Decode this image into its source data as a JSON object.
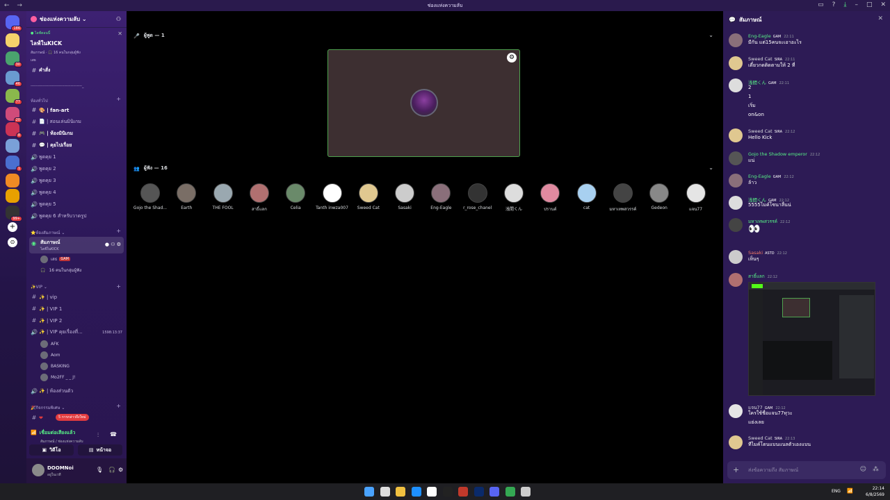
{
  "window": {
    "title": "ช่องแห่งความลับ",
    "nav": "← →"
  },
  "servers": [
    {
      "color": "#5865f2",
      "badge": "186"
    },
    {
      "color": "#f5d36b",
      "badge": ""
    },
    {
      "color": "#4aa36e",
      "badge": "30"
    },
    {
      "color": "#6a9ad0",
      "badge": "46"
    },
    {
      "color": "#8ab84c",
      "badge": "77"
    },
    {
      "color": "#d04b7a",
      "badge": "20"
    },
    {
      "color": "#cc3355",
      "badge": "8"
    },
    {
      "color": "#7aa0d8",
      "badge": ""
    },
    {
      "color": "#4a6fd0",
      "badge": "1"
    },
    {
      "color": "#f08a24",
      "badge": ""
    },
    {
      "color": "#e8a000",
      "badge": ""
    },
    {
      "color": "#333",
      "badge": "99+"
    }
  ],
  "server_header": {
    "name": "ช่องแห่งความลับ ⌄"
  },
  "event": {
    "label": "● ไลฟ์ตอนนี้",
    "title": "ไลฟ์ในKICK",
    "sub": "สัมภาษณ์ · 🎧 16 คนในกลุ่มผู้ฟัง",
    "sub2": "เสธ"
  },
  "channels": {
    "commands": "คำสั่ง",
    "divider": "-----------------------------------------_",
    "cat_general": "ห้องทั่วไป",
    "items": [
      "🎨 | fan-art",
      "📄 | สอนเล่นมินิเกม",
      "🎮 | ห้องมินิเกม",
      "💬 | คุยไปเรื่อย"
    ],
    "talk": [
      "พูดคุย 1",
      "พูดคุย 2",
      "พูดคุย 3",
      "พูดคุย 4",
      "พูดคุย 5",
      "พูดคุย 6 สำหรับวาดรูป"
    ],
    "cat_interview": "⭐ห้องสัมภาษณ์ ⌄",
    "active_stage": "สัมภาษณ์",
    "active_sub": "ไลฟ์ในKICK",
    "stage_user": "เสธ",
    "stage_tag": "GAM",
    "stage_listeners": "16 คนในกลุ่มผู้ฟัง",
    "cat_vip": "✨VIP ⌄",
    "vip": [
      "✨ | vip",
      "✨ | VIP 1",
      "✨ | VIP 2"
    ],
    "vip_voice": "✨ | VIP คุยเรื่องที่...",
    "vip_timer": "1598:13:37",
    "vip_users": [
      "AFK",
      "Aom",
      "BASKING",
      "Mo2FF _ _ J!"
    ],
    "private": "✨ | ห้องส่วนตัว",
    "cat_events": "🎉กิจกรรมพิเศษ ⌄",
    "new_msg": "5 การกล่าวถึงใหม่"
  },
  "voice": {
    "status": "เชื่อมต่อเสียงแล้ว",
    "sub": "สัมภาษณ์ / ช่องแห่งความลับ",
    "video": "วิดีโอ",
    "screen": "หน้าจอ"
  },
  "user": {
    "name": "DOOMNoi",
    "status": "อยู่ในเวที"
  },
  "stage": {
    "speakers_label": "ผู้พูด — 1",
    "audience_label": "ผู้ฟัง — 16",
    "audience": [
      {
        "name": "Gojo the Shad...",
        "color": "#555"
      },
      {
        "name": "Earth",
        "color": "#7a6e66"
      },
      {
        "name": "THE FOOL",
        "color": "#9aa8b0"
      },
      {
        "name": "สาธิ์แลก",
        "color": "#b07070"
      },
      {
        "name": "Celia",
        "color": "#6a8a6a"
      },
      {
        "name": "Tanth inwza007",
        "color": "#fff"
      },
      {
        "name": "Sweed Cat",
        "color": "#e0c890"
      },
      {
        "name": "Sasaki",
        "color": "#ccc"
      },
      {
        "name": "Eng-Eagle",
        "color": "#8a6f7a"
      },
      {
        "name": "r_rose_chanel",
        "color": "#333"
      },
      {
        "name": "浅間くん",
        "color": "#ddd"
      },
      {
        "name": "ปรานต์",
        "color": "#e08aa0"
      },
      {
        "name": "cat",
        "color": "#a8d0f0"
      },
      {
        "name": "มหาเทพสวรรค์",
        "color": "#444"
      },
      {
        "name": "Gedeon",
        "color": "#888"
      },
      {
        "name": "แจน77",
        "color": "#e5e5e5"
      }
    ]
  },
  "chat": {
    "title": "สัมภาษณ์",
    "placeholder": "ส่งข้อความถึง สัมภาษณ์",
    "messages": [
      {
        "user": "Eng-Eagle",
        "tag": "GAM",
        "time": "22:11",
        "lines": [
          "มีกัน แต่15คนจะเอาอะไร"
        ],
        "color": "#57f287",
        "av": "#8a6f7a"
      },
      {
        "user": "Sweed Cat",
        "tag": "SIRA",
        "time": "22:11",
        "lines": [
          "เดี๋ยวกดติดตามให้ 2 ที่"
        ],
        "color": "#dbdee1",
        "av": "#e0c890"
      },
      {
        "user": "浅間くん",
        "tag": "GAM",
        "time": "22:11",
        "lines": [
          "2",
          "1",
          "เริ่ม",
          "on&on"
        ],
        "color": "#57f287",
        "av": "#ddd"
      },
      {
        "user": "Sweed Cat",
        "tag": "SIRA",
        "time": "22:12",
        "lines": [
          "Hello Kick"
        ],
        "color": "#dbdee1",
        "av": "#e0c890"
      },
      {
        "user": "Gojo the Shadow emperor",
        "tag": "",
        "time": "22:12",
        "lines": [
          "แน่"
        ],
        "color": "#57f287",
        "av": "#555"
      },
      {
        "user": "Eng-Eagle",
        "tag": "GAM",
        "time": "22:12",
        "lines": [
          "ล้าว"
        ],
        "color": "#57f287",
        "av": "#8a6f7a"
      },
      {
        "user": "浅間くん",
        "tag": "GAM",
        "time": "22:12",
        "lines": [
          "5555ไมค์โซนาลื่นน่"
        ],
        "color": "#57f287",
        "av": "#ddd"
      },
      {
        "user": "มหาเทพสวรรค์",
        "tag": "",
        "time": "22:12",
        "lines": [
          "👀"
        ],
        "color": "#57f287",
        "av": "#444"
      },
      {
        "user": "Sasaki",
        "tag": "ASTD",
        "time": "22:12",
        "lines": [
          "เห็นๆ"
        ],
        "color": "#f47b67",
        "av": "#ccc"
      },
      {
        "user": "สาธิ์แลก",
        "tag": "",
        "time": "22:12",
        "lines": [],
        "color": "#57f287",
        "av": "#b07070"
      },
      {
        "user": "แจน77",
        "tag": "GAM",
        "time": "22:12",
        "lines": [
          "ใครใช้ชื่อแจน77ทุวะ",
          "แย่งเลย"
        ],
        "color": "#dbdee1",
        "av": "#e5e5e5"
      },
      {
        "user": "Sweed Cat",
        "tag": "SIRA",
        "time": "22:13",
        "lines": [
          "ทีไมค์โดนแบนแนลตัวเองแบน"
        ],
        "color": "#dbdee1",
        "av": "#e0c890"
      }
    ]
  },
  "taskbar": {
    "lang": "ENG",
    "time": "22:14",
    "date": "6/8/2569"
  }
}
